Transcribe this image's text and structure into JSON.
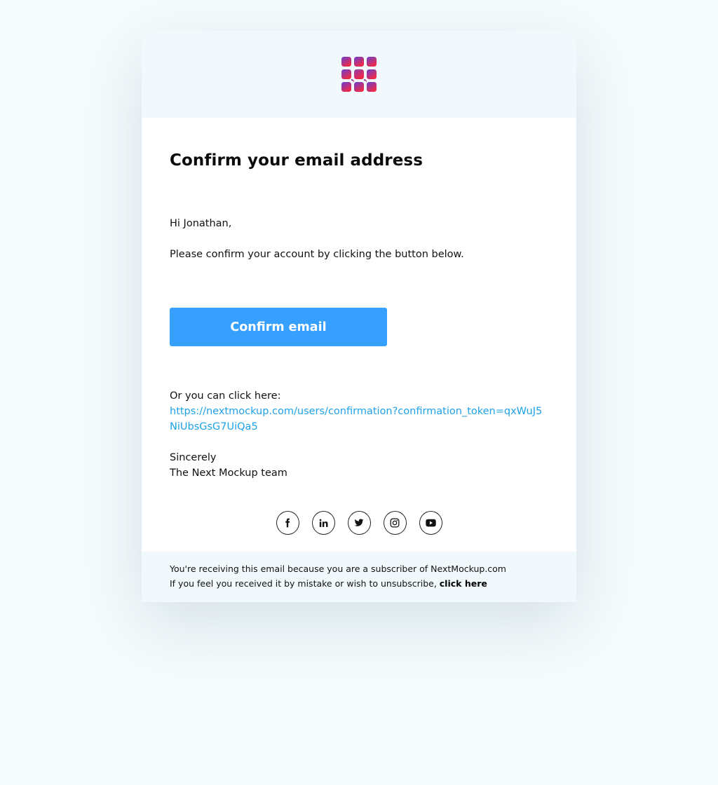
{
  "logo": {
    "icon": "grid-logo-icon",
    "gradient": [
      "#6a3fd0",
      "#f02a48"
    ]
  },
  "email": {
    "title": "Confirm your email address",
    "greeting": "Hi Jonathan,",
    "instruction": "Please confirm your account by clicking the button below.",
    "button_label": "Confirm email",
    "alt_label": "Or you can click here:",
    "confirmation_link": "https://nextmockup.com/users/confirmation?confirmation_token=qxWuJ5NiUbsGsG7UiQa5",
    "signoff_line1": "Sincerely",
    "signoff_line2": "The Next Mockup team"
  },
  "socials": [
    {
      "name": "facebook",
      "icon": "facebook-icon"
    },
    {
      "name": "linkedin",
      "icon": "linkedin-icon"
    },
    {
      "name": "twitter",
      "icon": "twitter-icon"
    },
    {
      "name": "instagram",
      "icon": "instagram-icon"
    },
    {
      "name": "youtube",
      "icon": "youtube-icon"
    }
  ],
  "footer": {
    "line1": "You're receiving this email because you are a subscriber of NextMockup.com",
    "line2_prefix": "If you feel you received it by mistake or wish to unsubscribe, ",
    "unsubscribe_link": "click here"
  },
  "colors": {
    "accent": "#37a0ff",
    "link": "#1fa2e8",
    "header_bg": "#f2f9fd",
    "page_bg": "#f6fcfe"
  }
}
